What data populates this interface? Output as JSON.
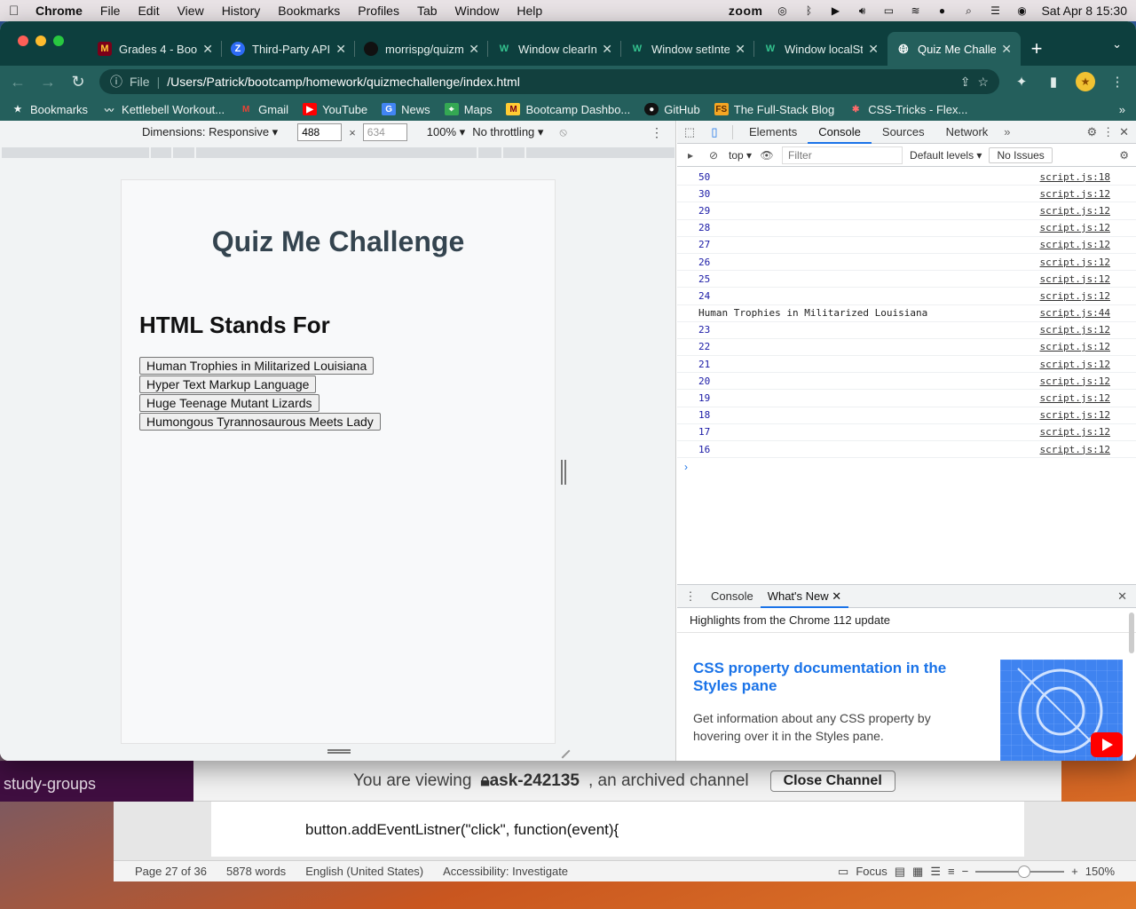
{
  "menubar": {
    "app": "Chrome",
    "items": [
      "File",
      "Edit",
      "View",
      "History",
      "Bookmarks",
      "Profiles",
      "Tab",
      "Window",
      "Help"
    ],
    "zoom": "zoom",
    "datetime": "Sat Apr 8  15:30"
  },
  "tabs": [
    {
      "title": "Grades 4 - Boot",
      "favicon": "M",
      "color": "#7a0019"
    },
    {
      "title": "Third-Party API",
      "favicon": "Z",
      "color": "#2d6bf5"
    },
    {
      "title": "morrispg/quizm",
      "favicon": "",
      "color": "#222"
    },
    {
      "title": "Window clearIn",
      "favicon": "W",
      "color": "#0e7c4a"
    },
    {
      "title": "Window setInte",
      "favicon": "W",
      "color": "#0e7c4a"
    },
    {
      "title": "Window localSt",
      "favicon": "W",
      "color": "#0e7c4a"
    },
    {
      "title": "Quiz Me Challe",
      "favicon": "",
      "color": "#ffffff",
      "active": true
    }
  ],
  "address": {
    "scheme_label": "File",
    "url": "/Users/Patrick/bootcamp/homework/quizmechallenge/index.html"
  },
  "bookmarks": [
    {
      "label": "Bookmarks",
      "icon": "star-icon"
    },
    {
      "label": "Kettlebell Workout...",
      "icon": "wave-icon"
    },
    {
      "label": "Gmail",
      "icon": "gmail-icon"
    },
    {
      "label": "YouTube",
      "icon": "youtube-icon"
    },
    {
      "label": "News",
      "icon": "news-icon"
    },
    {
      "label": "Maps",
      "icon": "maps-icon"
    },
    {
      "label": "Bootcamp Dashbo...",
      "icon": "bootcamp-icon"
    },
    {
      "label": "GitHub",
      "icon": "github-icon"
    },
    {
      "label": "The Full-Stack Blog",
      "icon": "fs-icon"
    },
    {
      "label": "CSS-Tricks - Flex...",
      "icon": "csstricks-icon"
    }
  ],
  "device_toolbar": {
    "dimensions": "Dimensions: Responsive ▾",
    "width": "488",
    "height": "634",
    "zoom": "100% ▾",
    "throttling": "No throttling ▾"
  },
  "page": {
    "title": "Quiz Me Challenge",
    "question": "HTML Stands For",
    "answers": [
      "Human Trophies in Militarized Louisiana",
      "Hyper Text Markup Language",
      "Huge Teenage Mutant Lizards",
      "Humongous Tyrannosaurous Meets Lady"
    ]
  },
  "devtools": {
    "tabs": [
      "Elements",
      "Console",
      "Sources",
      "Network"
    ],
    "active_tab": "Console",
    "context": "top ▾",
    "filter_placeholder": "Filter",
    "levels": "Default levels ▾",
    "issues": "No Issues",
    "logs": [
      {
        "value": "50",
        "source": "script.js:18",
        "type": "number"
      },
      {
        "value": "30",
        "source": "script.js:12",
        "type": "number"
      },
      {
        "value": "29",
        "source": "script.js:12",
        "type": "number"
      },
      {
        "value": "28",
        "source": "script.js:12",
        "type": "number"
      },
      {
        "value": "27",
        "source": "script.js:12",
        "type": "number"
      },
      {
        "value": "26",
        "source": "script.js:12",
        "type": "number"
      },
      {
        "value": "25",
        "source": "script.js:12",
        "type": "number"
      },
      {
        "value": "24",
        "source": "script.js:12",
        "type": "number"
      },
      {
        "value": "Human Trophies in Militarized Louisiana",
        "source": "script.js:44",
        "type": "string"
      },
      {
        "value": "23",
        "source": "script.js:12",
        "type": "number"
      },
      {
        "value": "22",
        "source": "script.js:12",
        "type": "number"
      },
      {
        "value": "21",
        "source": "script.js:12",
        "type": "number"
      },
      {
        "value": "20",
        "source": "script.js:12",
        "type": "number"
      },
      {
        "value": "19",
        "source": "script.js:12",
        "type": "number"
      },
      {
        "value": "18",
        "source": "script.js:12",
        "type": "number"
      },
      {
        "value": "17",
        "source": "script.js:12",
        "type": "number"
      },
      {
        "value": "16",
        "source": "script.js:12",
        "type": "number"
      }
    ],
    "drawer": {
      "tabs": [
        "Console",
        "What's New"
      ],
      "active_tab": "What's New",
      "highlights": "Highlights from the Chrome 112 update",
      "card_title": "CSS property documentation in the Styles pane",
      "card_desc": "Get information about any CSS property by hovering over it in the Styles pane."
    }
  },
  "background": {
    "slack_channel": "study-groups",
    "banner_prefix": "You are viewing",
    "banner_channel": "ask-242135",
    "banner_suffix": ", an archived channel",
    "banner_button": "Close Channel",
    "doc_line": "button.addEventListner(\"click\", function(event){",
    "status": {
      "page": "Page 27 of 36",
      "words": "5878 words",
      "language": "English (United States)",
      "accessibility": "Accessibility: Investigate",
      "focus": "Focus",
      "zoom": "150%"
    }
  }
}
